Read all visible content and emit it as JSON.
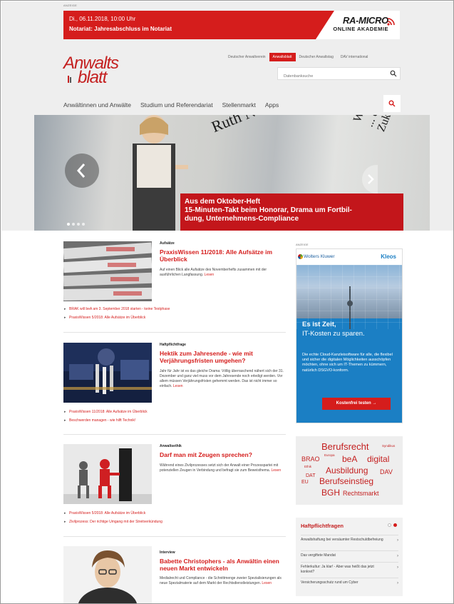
{
  "ad_label": "ANZEIGE",
  "banner": {
    "line1": "Di., 06.11.2018, 10:00 Uhr",
    "line2": "Notariat: Jahresabschluss im Notariat",
    "brand_name": "RA-MICRO",
    "brand_sub": "ONLINE AKADEMIE",
    "accent": "#d51d1c"
  },
  "logo": {
    "line1": "Anwalts",
    "line2": "blatt"
  },
  "top_nav": [
    "Deutscher Anwaltverein",
    "Anwaltsblatt",
    "Deutscher Anwaltstag",
    "DAV international"
  ],
  "top_nav_active": "Anwaltsblatt",
  "search": {
    "placeholder": "Datenbanksuche",
    "icon": "search-icon"
  },
  "main_nav": [
    "Anwältinnen und Anwälte",
    "Studium und Referendariat",
    "Stellenmarkt",
    "Apps"
  ],
  "hero": {
    "caption_line1": "Aus dem Oktober-Heft",
    "caption_line2": "15-Minuten-Takt beim Honorar, Drama um Fortbil-",
    "caption_line3": "dung, Unternehmens-Compliance",
    "paper_text_left": "Ruth No… Die Kombi",
    "paper_text_right": "Wir finden sind ... der ... Zukunftsreserve?",
    "slides": 4,
    "active_slide": 1
  },
  "articles": [
    {
      "category": "Aufsätze",
      "title": "PraxisWissen 11/2018: Alle Aufsätze im Überblick",
      "text": "Auf einen Blick alle Aufsätze des Novemberhefts zusammen mit der ausführlichen Langfassung.",
      "more": "Lesen",
      "links": [
        "BRAK will beA am 3. September 2018 starten - keine Testphase",
        "PraxisWissen 5/2018: Alle Aufsätze im Überblick"
      ]
    },
    {
      "category": "Haftpflichtfrage",
      "title": "Hektik zum Jahresende - wie mit Verjährungsfristen umgehen?",
      "text": "Jahr für Jahr ist es das gleiche Drama: Völlig überraschend nähert sich der 31. Dezember und ganz viel muss vor dem Jahresende noch erledigt werden. Vor allem müssen Verjährungsfristen gehemmt werden. Das ist nicht immer so einfach.",
      "more": "Lesen",
      "links": [
        "PraxisWissen 11/2018: Alle Aufsätze im Überblick",
        "Beschwerden managen - wie hilft Technik!"
      ]
    },
    {
      "category": "Anwaltsethik",
      "title": "Darf man mit Zeugen sprechen?",
      "text": "Während eines Zivilprozesses setzt sich der Anwalt einer Prozesspartei mit potenziellen Zeugen in Verbindung und befragt sie zum Beweisthema.",
      "more": "Lesen",
      "links": [
        "PraxisWissen 5/2018: Alle Aufsätze im Überblick",
        "Zivilprozess: Der richtige Umgang mit der Streitverkündung"
      ]
    },
    {
      "category": "Interview",
      "title": "Babette Christophers - als Anwältin einen neuen Markt entwickeln",
      "text": "Medialrecht und Compliance - die Schnittmenge zweier Spezialisierungen als neue Spezialmaterie auf dem Markt der Rechtsdienstleistungen.",
      "more": "Lesen"
    }
  ],
  "sidebar_ad": {
    "company": "Wolters Kluwer",
    "product": "Kleos",
    "headline1": "Es ist Zeit,",
    "headline2": "IT-Kosten zu sparen.",
    "body": "Die echte Cloud-Kanzleisoftware für alle, die flexibel und sicher die digitalen Möglichkeiten ausschöpfen möchten, ohne sich um IT-Themen zu kümmern, natürlich DSGVO-konform.",
    "cta": "Kostenfrei testen →"
  },
  "tag_cloud": [
    "Berufsrecht",
    "Syndikus",
    "BRAO",
    "Europa",
    "beA",
    "digital",
    "Ethik",
    "Ausbildung",
    "DAV",
    "DAT",
    "EU",
    "Berufseinstieg",
    "BGH",
    "Rechtsmarkt"
  ],
  "haftpflicht": {
    "title": "Haftpflichtfragen",
    "items": [
      "Anwaltshaftung bei versäumter Restschuldbefreiung",
      "Das vergiftete Mandat",
      "Fehlerkultur: Ja klar! - Aber was heißt das jetzt konkret?",
      "Versicherungsschutz rund um Cyber"
    ]
  }
}
